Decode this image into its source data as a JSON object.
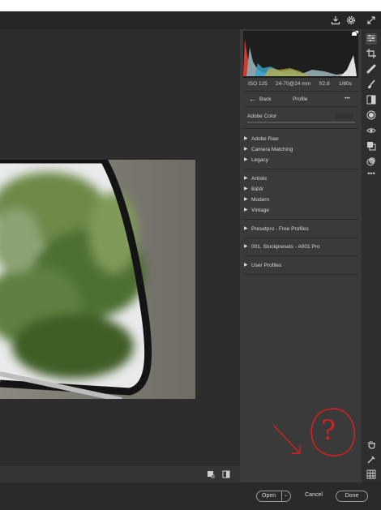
{
  "exif": {
    "iso": "ISO 125",
    "lens": "24-70@24 mm",
    "aperture": "f/2.8",
    "shutter": "1/80s"
  },
  "profile_header": {
    "back_label": "Back",
    "title": "Profile",
    "more": "•••"
  },
  "profile_name": "Adobe Color",
  "groups": [
    {
      "label": "Adobe Raw"
    },
    {
      "label": "Camera Matching"
    },
    {
      "label": "Legacy"
    },
    {
      "label": "Artistic"
    },
    {
      "label": "B&W"
    },
    {
      "label": "Modern"
    },
    {
      "label": "Vintage"
    },
    {
      "label": "Presetpro - Free Profiles"
    },
    {
      "label": "001. Stockpresets - A001 Pro"
    },
    {
      "label": "User Profiles"
    }
  ],
  "footer": {
    "open_label": "Open",
    "cancel_label": "Cancel",
    "done_label": "Done"
  },
  "annotation": {
    "text": "?",
    "color": "#d42020"
  },
  "colors": {
    "panel": "#3a3a3a",
    "canvas": "#2d2d2d",
    "toolstrip": "#2e2e2e",
    "accent": "#d42020"
  },
  "icons": [
    "save-icon",
    "settings-icon",
    "fullscreen-icon",
    "edit-sliders-icon",
    "crop-icon",
    "healing-icon",
    "brush-icon",
    "gradient-icon",
    "radial-filter-icon",
    "redeye-icon",
    "snapshots-icon",
    "presets-icon",
    "more-icon",
    "hand-icon",
    "sampler-icon",
    "grid-icon"
  ]
}
